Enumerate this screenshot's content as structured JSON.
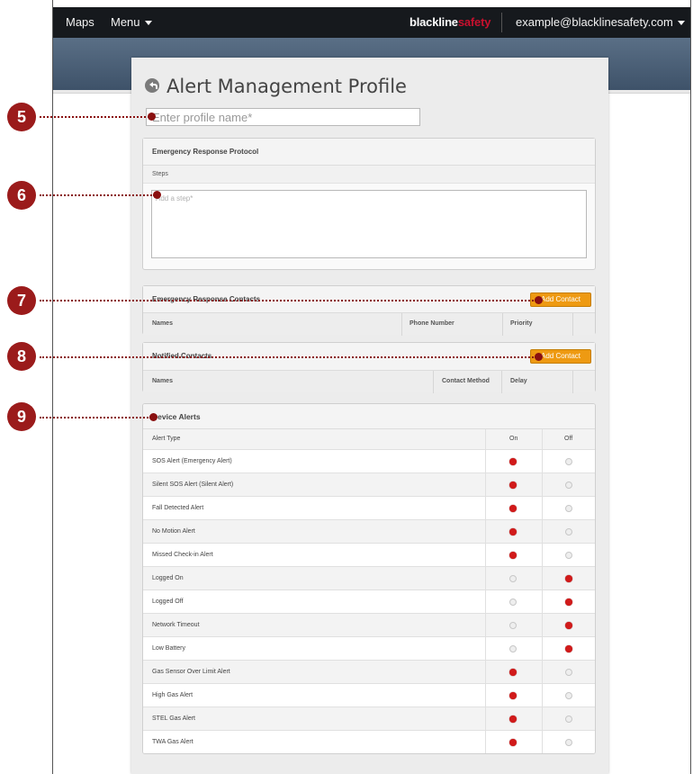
{
  "topbar": {
    "maps": "Maps",
    "menu": "Menu",
    "brand_primary": "blackline",
    "brand_accent": "safety",
    "account": "example@blacklinesafety.com"
  },
  "page": {
    "title": "Alert Management Profile",
    "name_placeholder": "Enter profile name*"
  },
  "emergency_protocol": {
    "title": "Emergency Response Protocol",
    "steps_label": "Steps",
    "step_placeholder": "Add a step*"
  },
  "emergency_contacts": {
    "title": "Emergency Response Contacts",
    "add_label": "Add Contact",
    "columns": [
      "Names",
      "Phone Number",
      "Priority"
    ]
  },
  "notified_contacts": {
    "title": "Notified Contacts",
    "add_label": "Add Contact",
    "columns": [
      "Names",
      "Contact Method",
      "Delay"
    ]
  },
  "device_alerts": {
    "title": "Device Alerts",
    "columns": {
      "type": "Alert Type",
      "on": "On",
      "off": "Off"
    },
    "rows": [
      {
        "label": "SOS Alert (Emergency Alert)",
        "on": true
      },
      {
        "label": "Silent SOS Alert (Silent Alert)",
        "on": true
      },
      {
        "label": "Fall Detected Alert",
        "on": true
      },
      {
        "label": "No Motion Alert",
        "on": true
      },
      {
        "label": "Missed Check-in Alert",
        "on": true
      },
      {
        "label": "Logged On",
        "on": false
      },
      {
        "label": "Logged Off",
        "on": false
      },
      {
        "label": "Network Timeout",
        "on": false
      },
      {
        "label": "Low Battery",
        "on": false
      },
      {
        "label": "Gas Sensor Over Limit Alert",
        "on": true
      },
      {
        "label": "High Gas Alert",
        "on": true
      },
      {
        "label": "STEL Gas Alert",
        "on": true
      },
      {
        "label": "TWA Gas Alert",
        "on": true
      }
    ]
  },
  "callouts": [
    "5",
    "6",
    "7",
    "8",
    "9"
  ],
  "colors": {
    "topbar": "#16191d",
    "accent_red": "#c8102e",
    "button_orange": "#ee9a12",
    "callout_red": "#9b1b1b"
  }
}
